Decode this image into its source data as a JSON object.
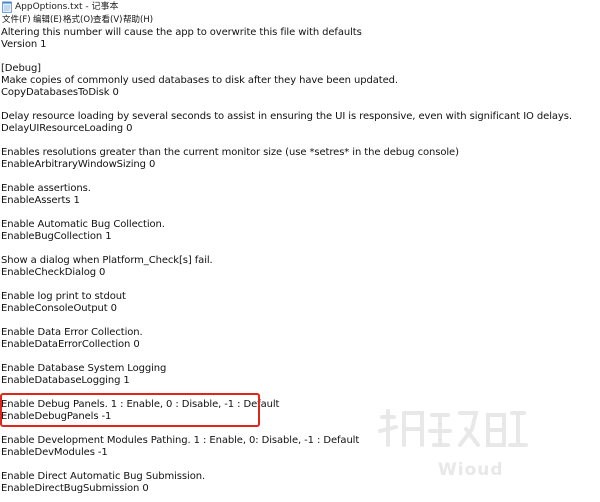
{
  "window": {
    "title": "AppOptions.txt - 记事本",
    "icon": "notepad-icon"
  },
  "menu": {
    "file": "文件(F)",
    "edit": "编辑(E)",
    "format": "格式(O)",
    "view": "查看(V)",
    "help": "帮助(H)"
  },
  "lines": [
    "Altering this number will cause the app to overwrite this file with defaults",
    "Version 1",
    "",
    "[Debug]",
    "Make copies of commonly used databases to disk after they have been updated.",
    "CopyDatabasesToDisk 0",
    "",
    "Delay resource loading by several seconds to assist in ensuring the UI is responsive, even with significant IO delays.",
    "DelayUIResourceLoading 0",
    "",
    "Enables resolutions greater than the current monitor size (use *setres* in the debug console)",
    "EnableArbitraryWindowSizing 0",
    "",
    "Enable assertions.",
    "EnableAsserts 1",
    "",
    "Enable Automatic Bug Collection.",
    "EnableBugCollection 1",
    "",
    "Show a dialog when Platform_Check[s] fail.",
    "EnableCheckDialog 0",
    "",
    "Enable log print to stdout",
    "EnableConsoleOutput 0",
    "",
    "Enable Data Error Collection.",
    "EnableDataErrorCollection 0",
    "",
    "Enable Database System Logging",
    "EnableDatabaseLogging 1",
    "",
    "Enable Debug Panels. 1 : Enable, 0 : Disable, -1 : Default",
    "EnableDebugPanels -1",
    "",
    "Enable Development Modules Pathing. 1 : Enable, 0: Disable, -1 : Default",
    "EnableDevModules -1",
    "",
    "Enable Direct Automatic Bug Submission.",
    "EnableDirectBugSubmission 0"
  ],
  "watermark": {
    "logo": "游民攻略组",
    "text": "Wioud"
  },
  "colors": {
    "highlight": "#e0251b"
  }
}
